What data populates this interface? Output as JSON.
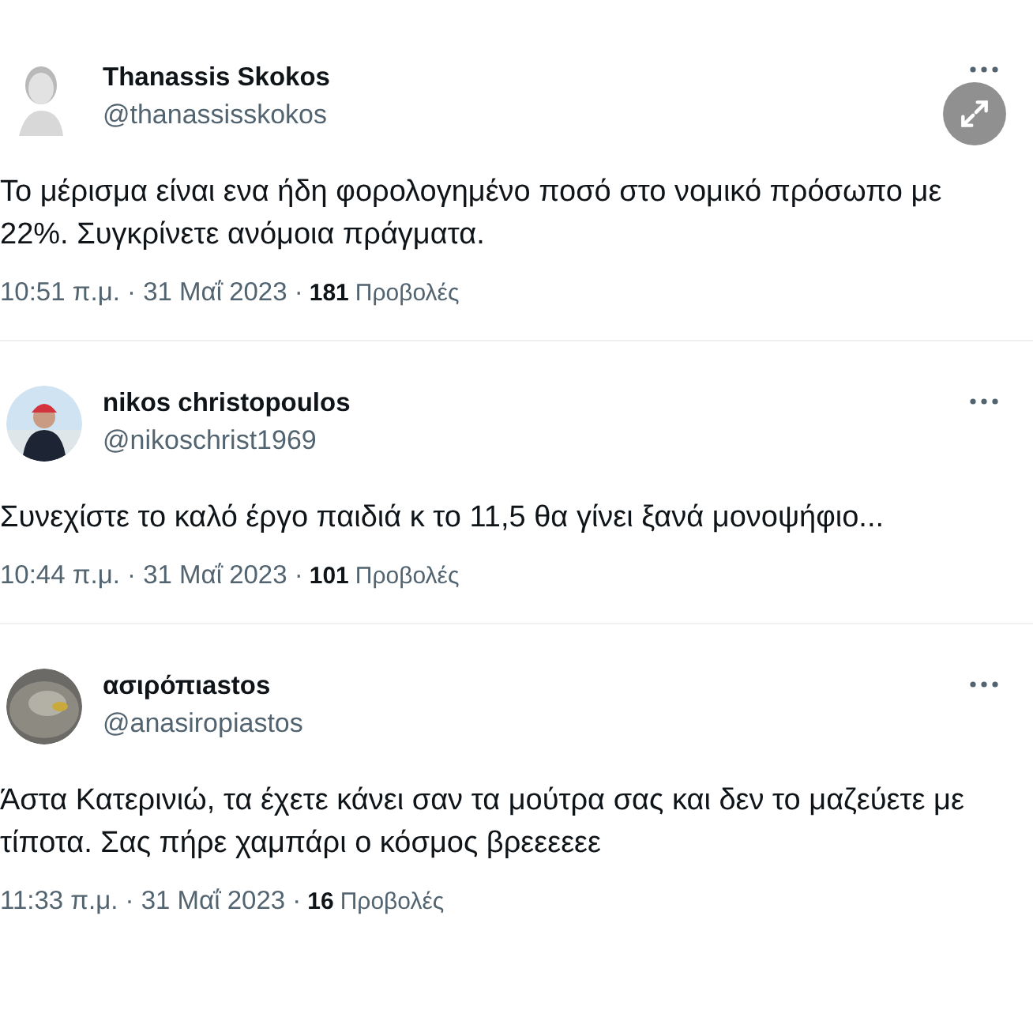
{
  "tweets": [
    {
      "name": "Thanassis Skokos",
      "handle": "@thanassisskokos",
      "text": "Το μέρισμα είναι ενα ήδη φορολογημένο ποσό στο νομικό πρόσωπο με 22%. Συγκρίνετε ανόμοια πράγματα.",
      "timestamp": "10:51 π.μ. · 31 Μαΐ 2023 ·",
      "views": "181",
      "views_label": "Προβολές"
    },
    {
      "name": "nikos christopoulos",
      "handle": "@nikoschrist1969",
      "text": "Συνεχίστε το καλό έργο παιδιά κ το 11,5 θα γίνει ξανά μονοψήφιο...",
      "timestamp": "10:44 π.μ. · 31 Μαΐ 2023 ·",
      "views": "101",
      "views_label": "Προβολές"
    },
    {
      "name": "ασιρόπιastos",
      "handle": "@anasiropiastos",
      "text": "Άστα Κατερινιώ, τα έχετε κάνει σαν τα μούτρα σας και δεν το μαζεύετε με τίποτα. Σας πήρε χαμπάρι ο κόσμος βρεεεεεε",
      "timestamp": "11:33 π.μ. · 31 Μαΐ 2023 ·",
      "views": "16",
      "views_label": "Προβολές"
    }
  ]
}
